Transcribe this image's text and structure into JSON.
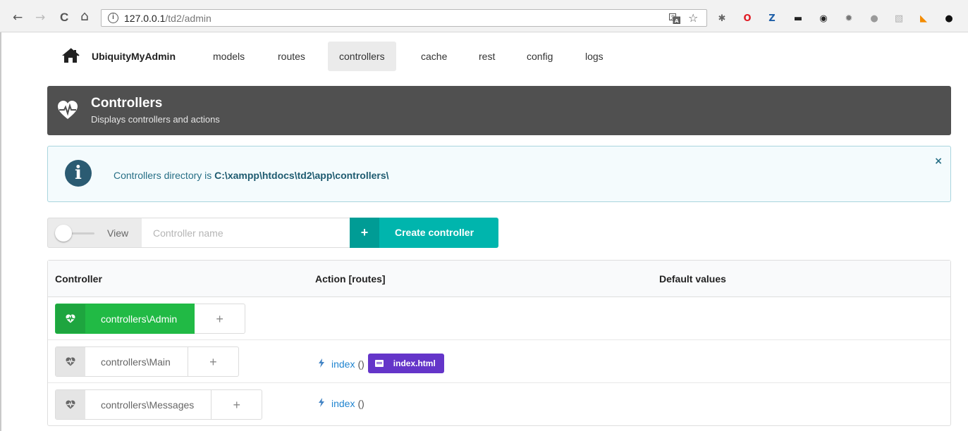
{
  "browser": {
    "back_icon": "←",
    "forward_icon": "→",
    "reload_icon": "C",
    "home_icon": "⌂",
    "info_icon": "i",
    "url_host": "127.0.0.1",
    "url_path": "/td2/admin",
    "translate_icon": "translate-icon",
    "star_icon": "☆",
    "extensions": [
      {
        "name": "bug-icon",
        "glyph": "✱",
        "color": "#666666"
      },
      {
        "name": "opera-icon",
        "glyph": "O",
        "color": "#e01b24"
      },
      {
        "name": "zotero-icon",
        "glyph": "Z",
        "color": "#1f5fa8"
      },
      {
        "name": "terminal-icon",
        "glyph": "▬",
        "color": "#222222"
      },
      {
        "name": "eye-icon",
        "glyph": "◉",
        "color": "#222222"
      },
      {
        "name": "gear-icon",
        "glyph": "✹",
        "color": "#777777"
      },
      {
        "name": "shield-icon",
        "glyph": "●",
        "color": "#9a9a9a"
      },
      {
        "name": "cast-icon",
        "glyph": "▧",
        "color": "#b0b0b0"
      },
      {
        "name": "rss-icon",
        "glyph": "◣",
        "color": "#f38b00"
      },
      {
        "name": "github-icon",
        "glyph": "●",
        "color": "#111111"
      }
    ]
  },
  "nav": {
    "brand": "UbiquityMyAdmin",
    "items": [
      {
        "label": "models",
        "active": false
      },
      {
        "label": "routes",
        "active": false
      },
      {
        "label": "controllers",
        "active": true
      },
      {
        "label": "cache",
        "active": false
      },
      {
        "label": "rest",
        "active": false
      },
      {
        "label": "config",
        "active": false
      },
      {
        "label": "logs",
        "active": false
      }
    ]
  },
  "header": {
    "title": "Controllers",
    "subtitle": "Displays controllers and actions"
  },
  "info": {
    "prefix": "Controllers directory is ",
    "path": "C:\\xampp\\htdocs\\td2\\app\\controllers\\",
    "close_icon": "×",
    "icon_glyph": "i"
  },
  "create": {
    "toggle_label": "View",
    "toggle_on": false,
    "input_placeholder": "Controller name",
    "input_value": "",
    "button_icon": "+",
    "button_label": "Create controller"
  },
  "table": {
    "headers": [
      "Controller",
      "Action [routes]",
      "Default values"
    ],
    "rows": [
      {
        "controller": "controllers\\Admin",
        "active": true,
        "add_icon": "+",
        "actions": []
      },
      {
        "controller": "controllers\\Main",
        "active": false,
        "add_icon": "+",
        "actions": [
          {
            "name": "index",
            "params": "()",
            "view": "index.html"
          }
        ]
      },
      {
        "controller": "controllers\\Messages",
        "active": false,
        "add_icon": "+",
        "actions": [
          {
            "name": "index",
            "params": "()",
            "view": ""
          }
        ]
      }
    ]
  },
  "colors": {
    "header_bg": "#505050",
    "teal": "#00b5ad",
    "green": "#21ba45",
    "violet": "#6435c9",
    "info_bg": "#f4fbfd",
    "link": "#2185d0"
  }
}
